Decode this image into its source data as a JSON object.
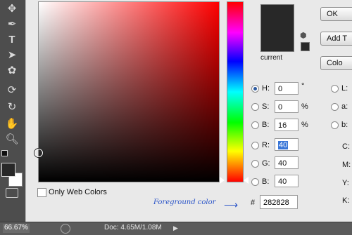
{
  "toolbar": {
    "icons": [
      "move-icon",
      "pen-icon",
      "type-icon",
      "select-arrow-icon",
      "shape-icon",
      "rotate-icon",
      "3d-orbit-icon",
      "hand-icon",
      "zoom-icon"
    ]
  },
  "color_field": {
    "selected_hex": "282828"
  },
  "swatch": {
    "current_label": "current"
  },
  "buttons": {
    "ok": "OK",
    "add_to_swatches": "Add T",
    "color_libraries": "Colo"
  },
  "hsb": {
    "h": {
      "label": "H:",
      "value": "0",
      "unit": "°"
    },
    "s": {
      "label": "S:",
      "value": "0",
      "unit": "%"
    },
    "b": {
      "label": "B:",
      "value": "16",
      "unit": "%"
    }
  },
  "rgb": {
    "r": {
      "label": "R:",
      "value": "40"
    },
    "g": {
      "label": "G:",
      "value": "40"
    },
    "b": {
      "label": "B:",
      "value": "40"
    }
  },
  "lab": {
    "l": "L:",
    "a": "a:",
    "b": "b:"
  },
  "cmyk": {
    "c": "C:",
    "m": "M:",
    "y": "Y:",
    "k": "K:"
  },
  "hex": {
    "label": "#",
    "value": "282828"
  },
  "only_web_colors": "Only Web Colors",
  "annotation": "Foreground color",
  "status": {
    "zoom": "66.67%",
    "doc": "Doc: 4.65M/1.08M"
  },
  "colors": {
    "current": "#282828",
    "accent": "#2b55c8"
  }
}
